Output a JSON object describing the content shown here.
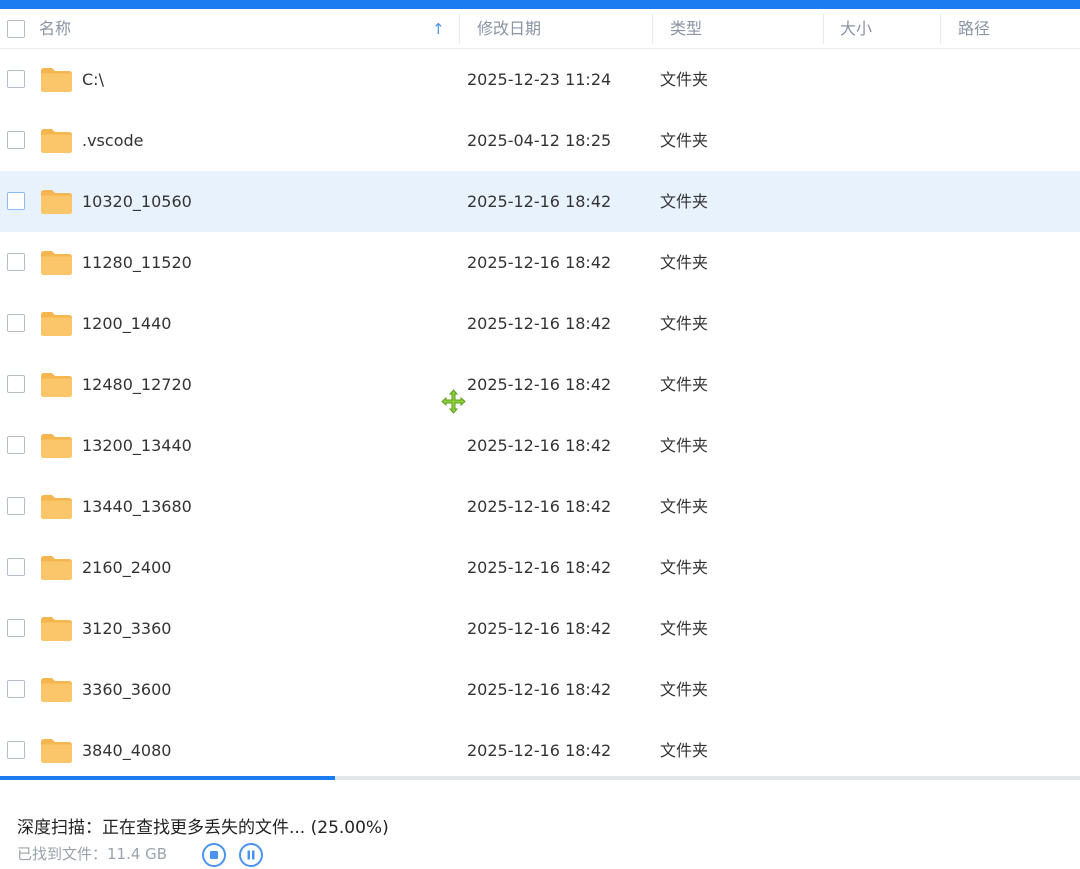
{
  "header": {
    "columns": {
      "name": "名称",
      "modified": "修改日期",
      "type": "类型",
      "size": "大小",
      "path": "路径"
    },
    "sort_icon": "arrow-up-icon"
  },
  "rows": [
    {
      "name": "C:\\",
      "date": "2025-12-23 11:24",
      "type": "文件夹",
      "selected": false
    },
    {
      "name": ".vscode",
      "date": "2025-04-12 18:25",
      "type": "文件夹",
      "selected": false
    },
    {
      "name": "10320_10560",
      "date": "2025-12-16 18:42",
      "type": "文件夹",
      "selected": true
    },
    {
      "name": "11280_11520",
      "date": "2025-12-16 18:42",
      "type": "文件夹",
      "selected": false
    },
    {
      "name": "1200_1440",
      "date": "2025-12-16 18:42",
      "type": "文件夹",
      "selected": false
    },
    {
      "name": "12480_12720",
      "date": "2025-12-16 18:42",
      "type": "文件夹",
      "selected": false
    },
    {
      "name": "13200_13440",
      "date": "2025-12-16 18:42",
      "type": "文件夹",
      "selected": false
    },
    {
      "name": "13440_13680",
      "date": "2025-12-16 18:42",
      "type": "文件夹",
      "selected": false
    },
    {
      "name": "2160_2400",
      "date": "2025-12-16 18:42",
      "type": "文件夹",
      "selected": false
    },
    {
      "name": "3120_3360",
      "date": "2025-12-16 18:42",
      "type": "文件夹",
      "selected": false
    },
    {
      "name": "3360_3600",
      "date": "2025-12-16 18:42",
      "type": "文件夹",
      "selected": false
    },
    {
      "name": "3840_4080",
      "date": "2025-12-16 18:42",
      "type": "文件夹",
      "selected": false
    }
  ],
  "scan": {
    "status_text": "深度扫描：正在查找更多丢失的文件... (25.00%)",
    "progress": 0.3102,
    "found_text": "已找到文件：11.4 GB"
  },
  "colors": {
    "accent": "#1a7cf0",
    "folder": "#fbc66a",
    "folder_tab": "#f5b54f",
    "selected_row": "#e8f2fd"
  },
  "icons": {
    "folder": "folder-icon",
    "stop": "stop-icon",
    "pause": "pause-icon",
    "cursor": "move-cursor-icon"
  }
}
